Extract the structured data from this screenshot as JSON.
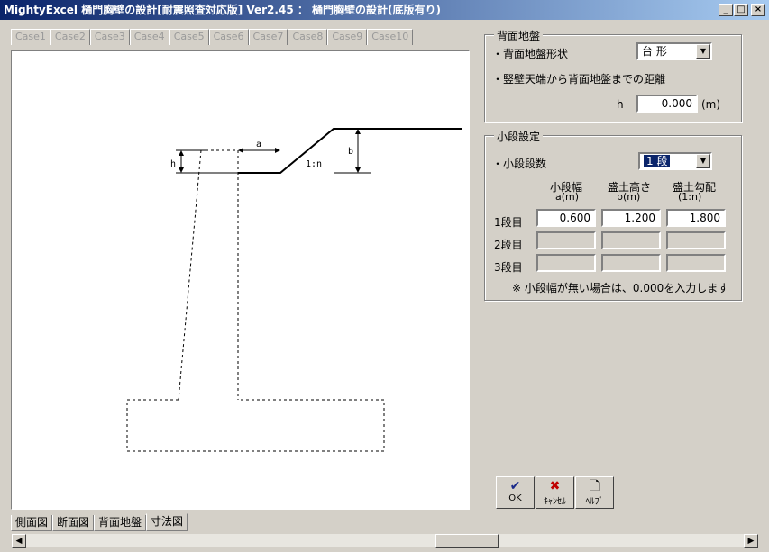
{
  "window": {
    "title": "MightyExcel 樋門胸壁の設計[耐震照査対応版] Ver2.45 ： 樋門胸壁の設計(底版有り)",
    "btn_minimize": "_",
    "btn_maximize": "□",
    "btn_close": "×"
  },
  "case_tabs": [
    "Case1",
    "Case2",
    "Case3",
    "Case4",
    "Case5",
    "Case6",
    "Case7",
    "Case8",
    "Case9",
    "Case10"
  ],
  "drawing": {
    "label_a": "a",
    "label_h": "h",
    "label_b": "b",
    "label_slope": "1:n"
  },
  "bottom_tabs": [
    "側面図",
    "断面図",
    "背面地盤",
    "寸法図"
  ],
  "bottom_active": "寸法図",
  "back_ground": {
    "legend": "背面地盤",
    "shape_label": "・背面地盤形状",
    "shape_value": "台 形",
    "distance_label": "・竪壁天端から背面地盤までの距離",
    "h_label": "h",
    "h_value": "0.000",
    "h_unit": "(m)"
  },
  "berm": {
    "legend": "小段設定",
    "count_label": "・小段段数",
    "count_value": "1 段",
    "col1_head1": "小段幅",
    "col1_head2": "a(m)",
    "col2_head1": "盛土高さ",
    "col2_head2": "b(m)",
    "col3_head1": "盛土勾配",
    "col3_head2": "(1:n)",
    "rows": [
      {
        "label": "1段目",
        "a": "0.600",
        "b": "1.200",
        "n": "1.800"
      },
      {
        "label": "2段目",
        "a": "",
        "b": "",
        "n": ""
      },
      {
        "label": "3段目",
        "a": "",
        "b": "",
        "n": ""
      }
    ],
    "note": "※ 小段幅が無い場合は、0.000を入力します"
  },
  "buttons": {
    "ok": "OK",
    "cancel": "ｷｬﾝｾﾙ",
    "help": "ﾍﾙﾌﾟ"
  },
  "colors": {
    "ok_icon": "#1a2a8a",
    "cancel_icon": "#c00000"
  }
}
